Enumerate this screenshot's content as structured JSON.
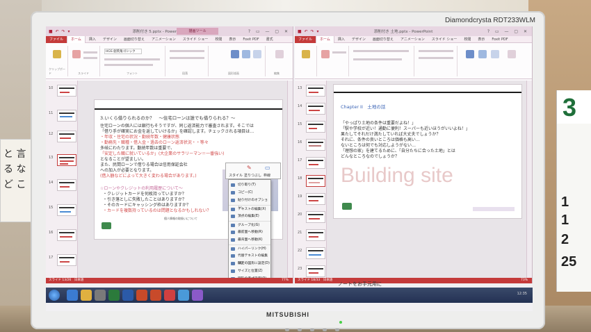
{
  "monitor": {
    "model": "Diamondcrysta RDT233WLM",
    "brand": "MITSUBISHI"
  },
  "room": {
    "calendar_top": "3",
    "calendar_row_1": "1",
    "calendar_row_2": "1",
    "calendar_row_3": "2",
    "calendar_row_4": "25"
  },
  "left_window": {
    "title": "添削付き 5.pptx - PowerPoint",
    "contextual_tab": "描画ツール",
    "tabs": [
      "ファイル",
      "ホーム",
      "挿入",
      "デザイン",
      "画面切り替え",
      "アニメーション",
      "スライド ショー",
      "校閲",
      "表示",
      "Foxit PDF",
      "書式"
    ],
    "active_tab": "ホーム",
    "ribbon_groups": [
      "クリップボード",
      "スライド",
      "フォント",
      "段落",
      "図形描画",
      "編集"
    ],
    "font_name": "HGS 創英角ゴシック",
    "slide_numbers": [
      "10",
      "11",
      "12",
      "13",
      "14",
      "15",
      "16",
      "17"
    ],
    "heading": "3.いくら借りられるのか？　～住宅ローンは誰でも借りられる？～",
    "body_lines": [
      "住宅ローンの個人には銀行もそうですが、同じ返済能力で審査されます。そこでは",
      "「借り手が確実にお金を返していけるか」を確認します。チェックされる項目は…",
      "・年収・住宅の状況・勤続年数・健康状態",
      "・勤務先・職種・借入金・過去のローン返済状況・・等々",
      "多岐にわたります。勤続年数は重要で、",
      "「安定した職に就いているか」(大企業のサラリーマン＝一番強い)",
      "となることが望ましい。",
      "また、民間ローンで借りる場合は信用保証会社",
      "への加入が必要となります。",
      "(借入額などによって大きく変わる場合があります。)"
    ],
    "body_lines_2": [
      "☆ローンやクレジットの利用履歴について～",
      "・クレジットカードを何枚持っていますか？",
      "・引き落としに失敗したことはありますか？",
      "・そのカードにキャッシング枠はありますか？",
      "・カードを複数持っているのは問題となるかもしれない？"
    ],
    "slide_footer": "個人情報の取扱いについて",
    "context_menu": [
      "切り取り(T)",
      "コピー(C)",
      "貼り付けのオプション:",
      "テキストの編集(X)",
      "頂点の編集(E)",
      "グループ化(G)",
      "最前面へ移動(R)",
      "最背面へ移動(K)",
      "ハイパーリンク(H)",
      "代替テキストの編集(A)",
      "既定の図形に設定(D)",
      "サイズと位置(Z)",
      "図形の書式設定(O)"
    ],
    "mini_toolbar": [
      "スタイル",
      "塗りつぶし",
      "枠線"
    ],
    "status": "スライド 13/26　日本語",
    "zoom": "77%"
  },
  "right_window": {
    "title": "添削付き 土地.pptx - PowerPoint",
    "tabs": [
      "ファイル",
      "ホーム",
      "挿入",
      "デザイン",
      "画面切り替え",
      "アニメーション",
      "スライド ショー",
      "校閲",
      "表示",
      "Foxit PDF"
    ],
    "active_tab": "ホーム",
    "slide_numbers": [
      "13",
      "14",
      "15",
      "16",
      "17",
      "18",
      "19",
      "20",
      "21",
      "22",
      "23"
    ],
    "chapter": "Chapter II　土地の話",
    "body_lines": [
      "「やっぱり土地の条件は重要だよね！」",
      "「駅や学校が近い！通勤に便利！スーパーも近いほうがいいよね！」",
      "果たしてそれだけ満たしていれば大丈夫でしょうか？",
      "それに、条件の良いところは価格も高い…",
      "ないところは何でも対応しようがない…",
      "「理想の家」を建てるために、「自分たちに合った土地」とは",
      "どんなところなのでしょうか？"
    ],
    "watermark": "Building site",
    "status": "スライド 18/33　日本語",
    "zoom": "73%"
  },
  "notes_caption": "ノートをお手元用に",
  "taskbar": {
    "tray_time": "12:35"
  }
}
